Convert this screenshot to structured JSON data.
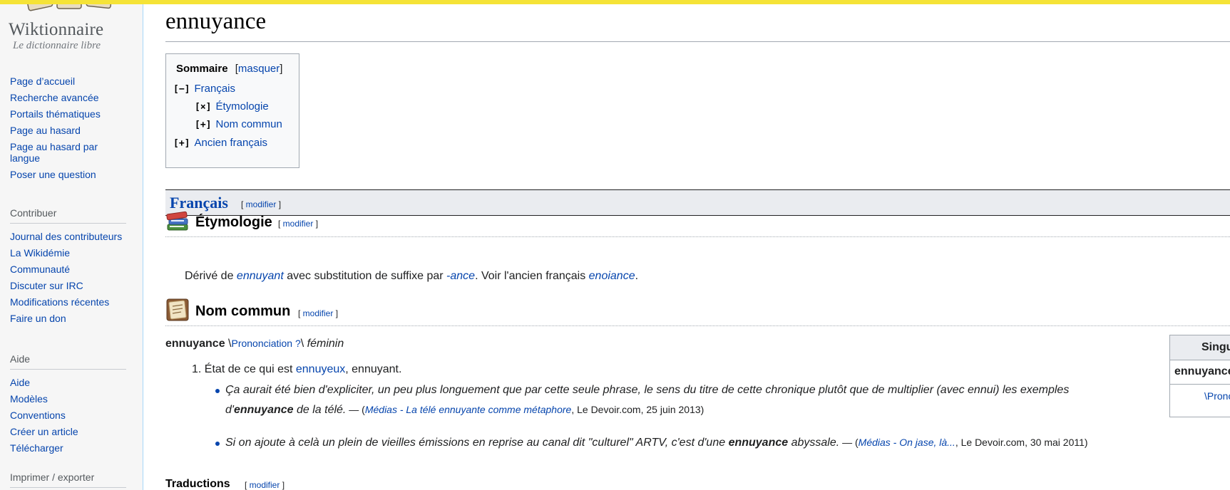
{
  "logo": {
    "title": "Wiktionnaire",
    "subtitle": "Le dictionnaire libre"
  },
  "sidebar": {
    "nav": [
      "Page d’accueil",
      "Recherche avancée",
      "Portails thématiques",
      "Page au hasard",
      "Page au hasard par langue",
      "Poser une question"
    ],
    "contribute_heading": "Contribuer",
    "contribute": [
      "Journal des contributeurs",
      "La Wikidémie",
      "Communauté",
      "Discuter sur IRC",
      "Modifications récentes",
      "Faire un don"
    ],
    "help_heading": "Aide",
    "help": [
      "Aide",
      "Modèles",
      "Conventions",
      "Créer un article",
      "Télécharger"
    ],
    "print_heading": "Imprimer / exporter"
  },
  "page": {
    "title": "ennuyance"
  },
  "toc": {
    "title": "Sommaire",
    "toggle_open": "[",
    "toggle_label": "masquer",
    "toggle_close": "]",
    "items": [
      {
        "mark": "[−]",
        "label": "Français"
      },
      {
        "mark": "[×]",
        "label": "Étymologie"
      },
      {
        "mark": "[+]",
        "label": "Nom commun"
      },
      {
        "mark": "[+]",
        "label": "Ancien français"
      }
    ]
  },
  "edit": {
    "open": "[ ",
    "label": "modifier",
    "close": " ]"
  },
  "lang": {
    "title": "Français"
  },
  "etymology": {
    "title": "Étymologie",
    "t1": "Dérivé de ",
    "l1": "ennuyant",
    "t2": " avec substitution de suffixe par ",
    "l2": "-ance",
    "t3": ". Voir l'ancien français ",
    "l3": "enoiance",
    "t4": "."
  },
  "noun": {
    "title": "Nom commun",
    "headword": "ennuyance",
    "pron_open": " \\",
    "pron_link": "Prononciation ?",
    "pron_close": "\\ ",
    "gender": "féminin"
  },
  "definition": {
    "number": "1.",
    "t1": "État de ce qui est ",
    "link": "ennuyeux",
    "t2": ", ennuyant."
  },
  "example1": {
    "line1": "Ça aurait été bien d'expliciter, un peu plus longuement que par cette seule phrase, le sens du titre de cette chronique plutôt que de multiplier (avec ennui) les exemples",
    "pre": "d'",
    "word": "ennuyance",
    "post": " de la télé.",
    "src_open": " — (",
    "src_link": "Médias - La télé ennuyante comme métaphore",
    "src_rest": ", Le Devoir.com, 25 juin 2013)"
  },
  "example2": {
    "pre": "Si on ajoute à celà un plein de vieilles émissions en reprise au canal dit \"culturel\" ARTV, c'est d'une ",
    "word": "ennuyance",
    "post": " abyssale.",
    "src_open": " — (",
    "src_link": "Médias - On jase, là...",
    "src_rest": ", Le Devoir.com, 30 mai 2011)"
  },
  "flex_table": {
    "header": "Singulier",
    "form": "ennuyance",
    "pron": "\\Prononciation ?\\"
  },
  "translations": {
    "title": "Traductions"
  }
}
